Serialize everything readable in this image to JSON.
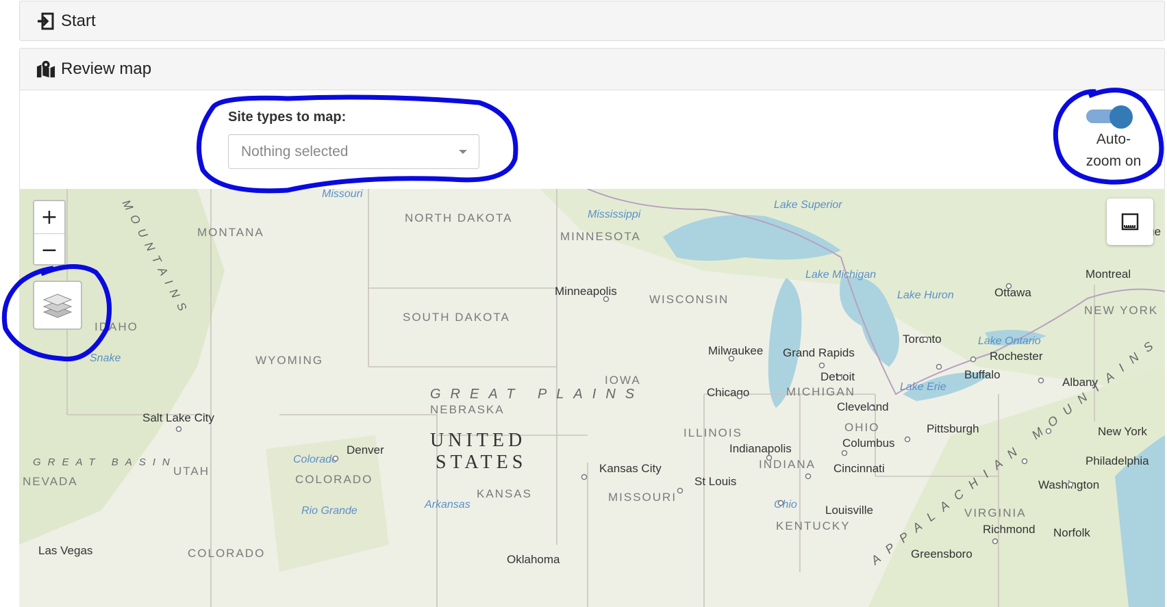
{
  "panels": {
    "start": {
      "title": "Start",
      "icon": "sign-in-icon"
    },
    "review": {
      "title": "Review map",
      "icon": "map-marked-icon"
    }
  },
  "filters": {
    "site_types_label": "Site types to map:",
    "site_types_value": "Nothing selected"
  },
  "autozoom": {
    "label_line1": "Auto-",
    "label_line2": "zoom on",
    "enabled": true
  },
  "map_controls": {
    "zoom_in": "+",
    "zoom_out": "−"
  },
  "map_labels": {
    "states": [
      "MONTANA",
      "NORTH DAKOTA",
      "MINNESOTA",
      "SOUTH DAKOTA",
      "WISCONSIN",
      "WYOMING",
      "IDAHO",
      "IOWA",
      "NEBRASKA",
      "MICHIGAN",
      "ILLINOIS",
      "INDIANA",
      "OHIO",
      "UTAH",
      "NEVADA",
      "COLORADO",
      "KANSAS",
      "MISSOURI",
      "KENTUCKY",
      "VIRGINIA",
      "NEW YORK",
      "COLORADO"
    ],
    "cities": [
      "Minneapolis",
      "Milwaukee",
      "Grand Rapids",
      "Detroit",
      "Chicago",
      "Toronto",
      "Rochester",
      "Buffalo",
      "Albany",
      "Ottawa",
      "Montreal",
      "Cleveland",
      "Columbus",
      "Pittsburgh",
      "Indianapolis",
      "Cincinnati",
      "St Louis",
      "Kansas City",
      "Denver",
      "Salt Lake City",
      "Louisville",
      "Richmond",
      "Norfolk",
      "Washington",
      "Philadelphia",
      "New York",
      "Greensboro",
      "Las Vegas",
      "Oklahoma",
      "Que"
    ],
    "water": [
      "Lake Superior",
      "Lake Michigan",
      "Lake Huron",
      "Lake Ontario",
      "Lake Erie",
      "Missouri",
      "Mississippi",
      "Snake",
      "Colorado",
      "Rio Grande",
      "Arkansas",
      "Ohio"
    ],
    "regions": [
      "GREAT PLAINS",
      "GREAT BASIN",
      "APPALACHIAN MOUNTAINS",
      "MOUNTAINS"
    ],
    "country": [
      "UNITED",
      "STATES"
    ]
  },
  "annotation_color": "#0a0adf",
  "accent": "#337ab7"
}
